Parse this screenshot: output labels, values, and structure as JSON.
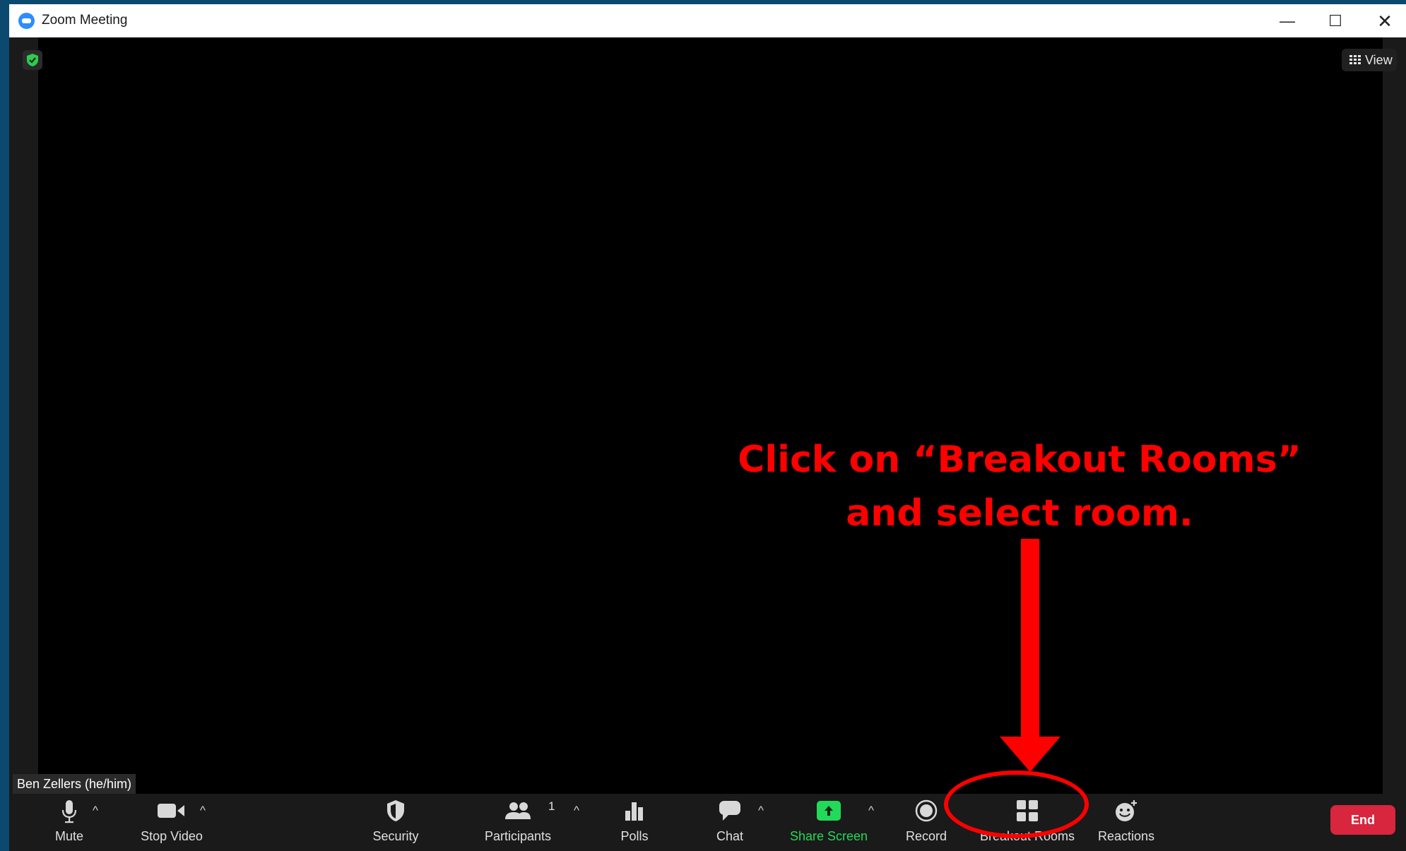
{
  "window": {
    "title": "Zoom Meeting",
    "controls": {
      "minimize": "—",
      "maximize": "☐",
      "close": "✕"
    }
  },
  "stage": {
    "view_label": "View",
    "participant_name": "Ben Zellers (he/him)"
  },
  "annotation": {
    "line1": "Click on “Breakout Rooms”",
    "line2": "and select room.",
    "color": "#ff0000"
  },
  "toolbar": {
    "mute": "Mute",
    "stop_video": "Stop Video",
    "security": "Security",
    "participants": "Participants",
    "participant_count": "1",
    "polls": "Polls",
    "chat": "Chat",
    "share_screen": "Share Screen",
    "record": "Record",
    "breakout_rooms": "Breakout Rooms",
    "reactions": "Reactions",
    "end": "End"
  },
  "colors": {
    "share_green": "#23d959",
    "end_red": "#d7263d",
    "security_green": "#2ecc52"
  },
  "icons": [
    "zoom-logo-icon",
    "security-shield-icon",
    "grid-view-icon",
    "microphone-icon",
    "video-camera-icon",
    "shield-icon",
    "participants-icon",
    "polls-icon",
    "chat-bubble-icon",
    "share-screen-icon",
    "record-icon",
    "breakout-rooms-icon",
    "reactions-icon",
    "chevron-up-icon"
  ]
}
